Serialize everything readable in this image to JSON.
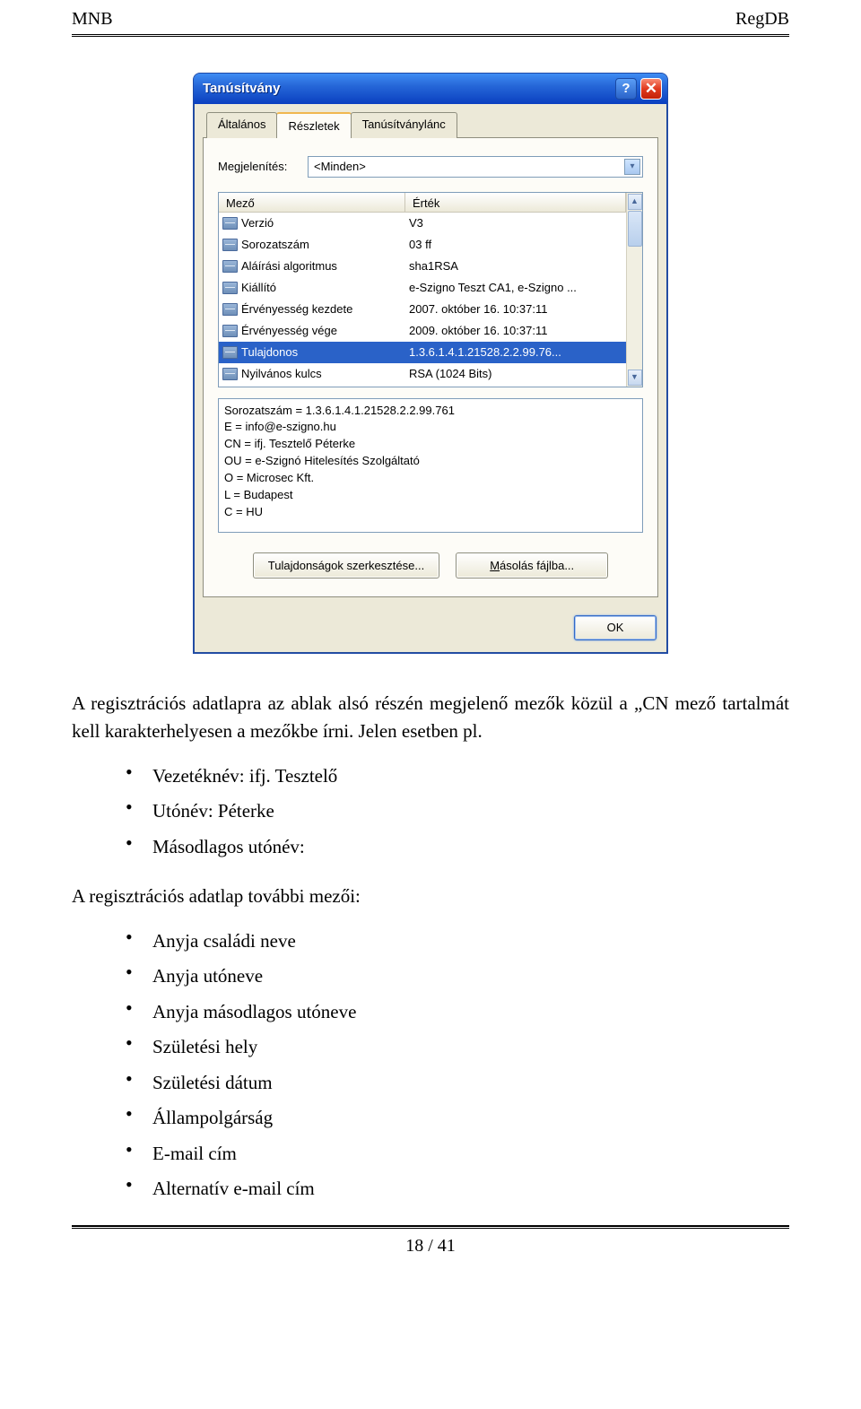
{
  "header": {
    "left": "MNB",
    "right": "RegDB"
  },
  "dialog": {
    "title": "Tanúsítvány",
    "tabs": [
      "Általános",
      "Részletek",
      "Tanúsítványlánc"
    ],
    "active_tab": 1,
    "display_label": "Megjelenítés:",
    "display_value": "<Minden>",
    "columns": [
      "Mező",
      "Érték"
    ],
    "rows": [
      {
        "field": "Verzió",
        "value": "V3",
        "selected": false
      },
      {
        "field": "Sorozatszám",
        "value": "03 ff",
        "selected": false
      },
      {
        "field": "Aláírási algoritmus",
        "value": "sha1RSA",
        "selected": false
      },
      {
        "field": "Kiállító",
        "value": "e-Szigno Teszt CA1, e-Szigno ...",
        "selected": false
      },
      {
        "field": "Érvényesség kezdete",
        "value": "2007. október 16. 10:37:11",
        "selected": false
      },
      {
        "field": "Érvényesség vége",
        "value": "2009. október 16. 10:37:11",
        "selected": false
      },
      {
        "field": "Tulajdonos",
        "value": "1.3.6.1.4.1.21528.2.2.99.76...",
        "selected": true
      },
      {
        "field": "Nyilvános kulcs",
        "value": "RSA (1024 Bits)",
        "selected": false
      }
    ],
    "detail_text": "Sorozatszám = 1.3.6.1.4.1.21528.2.2.99.761\nE = info@e-szigno.hu\nCN = ifj. Tesztelő Péterke\nOU = e-Szignó Hitelesítés Szolgáltató\nO = Microsec Kft.\nL = Budapest\nC = HU",
    "btn_edit": "Tulajdonságok szerkesztése...",
    "btn_copy": "Másolás fájlba...",
    "btn_ok": "OK"
  },
  "body": {
    "para1": "A regisztrációs adatlapra az ablak alsó részén megjelenő mezők közül a „CN mező tartalmát kell karakterhelyesen a mezőkbe írni. Jelen esetben pl.",
    "list1": [
      "Vezetéknév: ifj. Tesztelő",
      "Utónév: Péterke",
      "Másodlagos utónév:"
    ],
    "para2": "A regisztrációs adatlap további mezői:",
    "list2": [
      "Anyja családi neve",
      "Anyja utóneve",
      "Anyja másodlagos utóneve",
      "Születési hely",
      "Születési dátum",
      "Állampolgárság",
      "E-mail cím",
      "Alternatív e-mail cím"
    ]
  },
  "footer": {
    "page": "18 / 41"
  }
}
